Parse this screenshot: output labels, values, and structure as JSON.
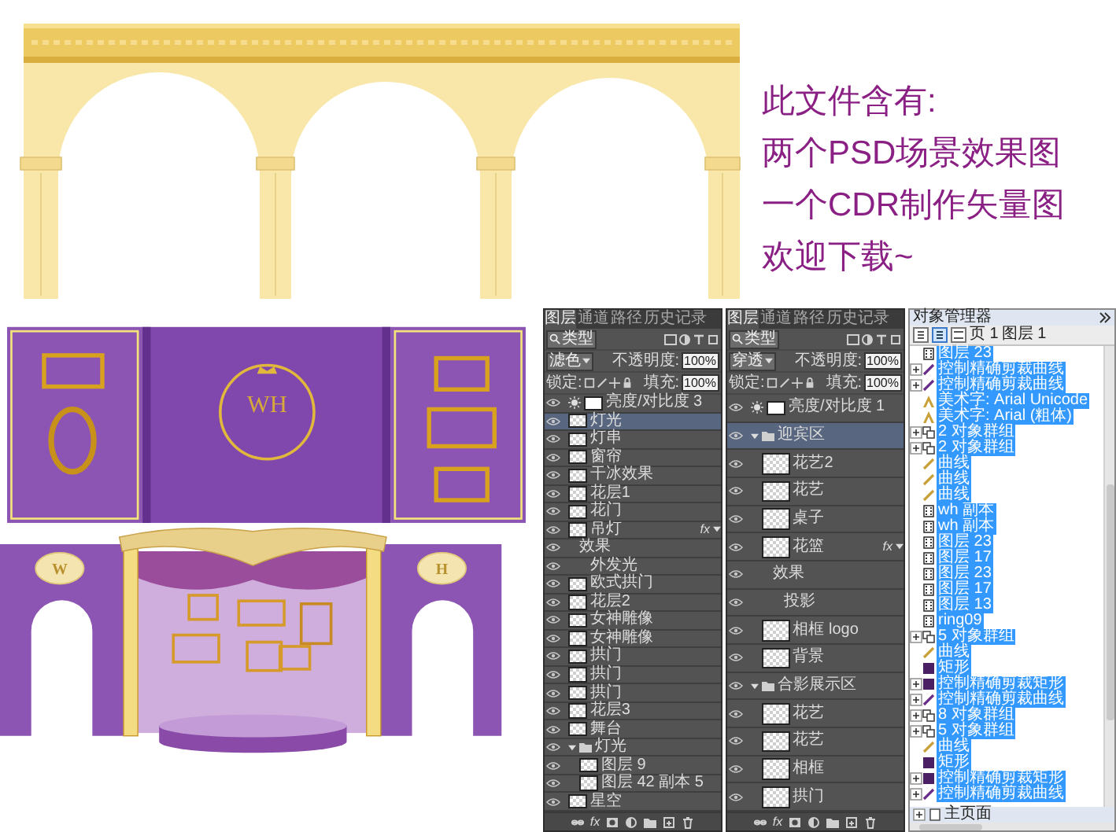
{
  "note": {
    "lines": [
      "此文件含有:",
      "两个PSD场景效果图",
      "一个CDR制作矢量图",
      "欢迎下载~"
    ]
  },
  "scenes": [
    {
      "kind": "triple-panel-backdrop",
      "monogram": "WH"
    },
    {
      "kind": "arch-stage",
      "badges": [
        "W",
        "H"
      ]
    }
  ],
  "ps_panels": [
    {
      "tabs": [
        {
          "label": "图层",
          "selected": true
        },
        {
          "label": "通道",
          "selected": false
        },
        {
          "label": "路径",
          "selected": false
        },
        {
          "label": "历史记录",
          "selected": false
        }
      ],
      "filter": "类型",
      "blend_mode": "滤色",
      "opacity_label": "不透明度:",
      "opacity": "100%",
      "lock_label": "锁定:",
      "fill_label": "填充:",
      "fill": "100%",
      "footer_fx": "fx",
      "layers": [
        {
          "kind": "adjustment",
          "name": "亮度/对比度 3",
          "selected": false
        },
        {
          "kind": "layer",
          "name": "灯光",
          "selected": true
        },
        {
          "kind": "layer",
          "name": "灯串",
          "selected": false
        },
        {
          "kind": "layer",
          "name": "窗帘",
          "selected": false
        },
        {
          "kind": "layer",
          "name": "干冰效果",
          "selected": false
        },
        {
          "kind": "layer",
          "name": "花层1",
          "selected": false
        },
        {
          "kind": "layer",
          "name": "花门",
          "selected": false
        },
        {
          "kind": "layer",
          "name": "吊灯",
          "selected": false,
          "badge": "fx",
          "expanded": true,
          "children": [
            {
              "kind": "effect",
              "name": "效果",
              "children": [
                {
                  "kind": "effect",
                  "name": "外发光"
                }
              ]
            }
          ]
        },
        {
          "kind": "layer",
          "name": "欧式拱门",
          "selected": false
        },
        {
          "kind": "layer",
          "name": "花层2",
          "selected": false
        },
        {
          "kind": "layer",
          "name": "女神雕像",
          "selected": false
        },
        {
          "kind": "layer",
          "name": "女神雕像",
          "selected": false
        },
        {
          "kind": "layer",
          "name": "拱门",
          "selected": false
        },
        {
          "kind": "layer",
          "name": "拱门",
          "selected": false
        },
        {
          "kind": "layer",
          "name": "拱门",
          "selected": false
        },
        {
          "kind": "layer",
          "name": "花层3",
          "selected": false
        },
        {
          "kind": "layer",
          "name": "舞台",
          "selected": false
        },
        {
          "kind": "group",
          "name": "灯光",
          "selected": false,
          "expanded": true,
          "children": [
            {
              "kind": "layer",
              "name": "图层 9",
              "selected": false
            },
            {
              "kind": "layer",
              "name": "图层 42 副本 5",
              "selected": false
            }
          ]
        },
        {
          "kind": "layer",
          "name": "星空",
          "selected": false
        }
      ]
    },
    {
      "tabs": [
        {
          "label": "图层",
          "selected": true
        },
        {
          "label": "通道",
          "selected": false
        },
        {
          "label": "路径",
          "selected": false
        },
        {
          "label": "历史记录",
          "selected": false
        }
      ],
      "filter": "类型",
      "blend_mode": "穿透",
      "opacity_label": "不透明度:",
      "opacity": "100%",
      "lock_label": "锁定:",
      "fill_label": "填充:",
      "fill": "100%",
      "footer_fx": "fx",
      "layers": [
        {
          "kind": "adjustment",
          "name": "亮度/对比度 1",
          "selected": false
        },
        {
          "kind": "group",
          "name": "迎宾区",
          "selected": true,
          "expanded": true,
          "children": [
            {
              "kind": "layer",
              "name": "花艺2",
              "selected": false
            },
            {
              "kind": "layer",
              "name": "花艺",
              "selected": false
            },
            {
              "kind": "layer",
              "name": "桌子",
              "selected": false
            },
            {
              "kind": "layer",
              "name": "花篮",
              "selected": false,
              "badge": "fx",
              "expanded": true,
              "children": [
                {
                  "kind": "effect",
                  "name": "效果",
                  "children": [
                    {
                      "kind": "effect",
                      "name": "投影"
                    }
                  ]
                }
              ]
            },
            {
              "kind": "layer",
              "name": "相框 logo",
              "selected": false
            },
            {
              "kind": "layer",
              "name": "背景",
              "selected": false
            }
          ]
        },
        {
          "kind": "group",
          "name": "合影展示区",
          "selected": false,
          "expanded": true,
          "children": [
            {
              "kind": "layer",
              "name": "花艺",
              "selected": false
            },
            {
              "kind": "layer",
              "name": "花艺",
              "selected": false
            },
            {
              "kind": "layer",
              "name": "相框",
              "selected": false
            },
            {
              "kind": "layer",
              "name": "拱门",
              "selected": false
            }
          ]
        }
      ]
    }
  ],
  "object_manager": {
    "title": "对象管理器",
    "page": "页 1",
    "layer": "图层 1",
    "footer": "主页面",
    "items": [
      {
        "kind": "bitmap",
        "name": "图层 23",
        "selected": true
      },
      {
        "kind": "clip-curve",
        "name": "控制精确剪裁曲线",
        "selected": true
      },
      {
        "kind": "clip-curve",
        "name": "控制精确剪裁曲线",
        "selected": true
      },
      {
        "kind": "text",
        "name": "美术字: Arial Unicode",
        "selected": true
      },
      {
        "kind": "text",
        "name": "美术字: Arial (粗体)",
        "selected": true
      },
      {
        "kind": "group",
        "name": "2 对象群组",
        "selected": true
      },
      {
        "kind": "group",
        "name": "2 对象群组",
        "selected": true
      },
      {
        "kind": "curve",
        "name": "曲线",
        "selected": true
      },
      {
        "kind": "curve",
        "name": "曲线",
        "selected": true
      },
      {
        "kind": "curve",
        "name": "曲线",
        "selected": true
      },
      {
        "kind": "bitmap",
        "name": "wh 副本",
        "selected": true
      },
      {
        "kind": "bitmap",
        "name": "wh 副本",
        "selected": true
      },
      {
        "kind": "bitmap",
        "name": "图层 23",
        "selected": true
      },
      {
        "kind": "bitmap",
        "name": "图层 17",
        "selected": true
      },
      {
        "kind": "bitmap",
        "name": "图层 23",
        "selected": true
      },
      {
        "kind": "bitmap",
        "name": "图层 17",
        "selected": true
      },
      {
        "kind": "bitmap",
        "name": "图层 13",
        "selected": true
      },
      {
        "kind": "bitmap",
        "name": "ring09",
        "selected": true
      },
      {
        "kind": "group",
        "name": "5 对象群组",
        "selected": true
      },
      {
        "kind": "curve",
        "name": "曲线",
        "selected": true
      },
      {
        "kind": "rect",
        "name": "矩形",
        "selected": true
      },
      {
        "kind": "clip-rect",
        "name": "控制精确剪裁矩形",
        "selected": true
      },
      {
        "kind": "clip-curve",
        "name": "控制精确剪裁曲线",
        "selected": true
      },
      {
        "kind": "group",
        "name": "8 对象群组",
        "selected": true
      },
      {
        "kind": "group",
        "name": "5 对象群组",
        "selected": true
      },
      {
        "kind": "curve",
        "name": "曲线",
        "selected": true
      },
      {
        "kind": "rect",
        "name": "矩形",
        "selected": true
      },
      {
        "kind": "clip-rect",
        "name": "控制精确剪裁矩形",
        "selected": true
      },
      {
        "kind": "clip-curve",
        "name": "控制精确剪裁曲线",
        "selected": true
      }
    ]
  }
}
